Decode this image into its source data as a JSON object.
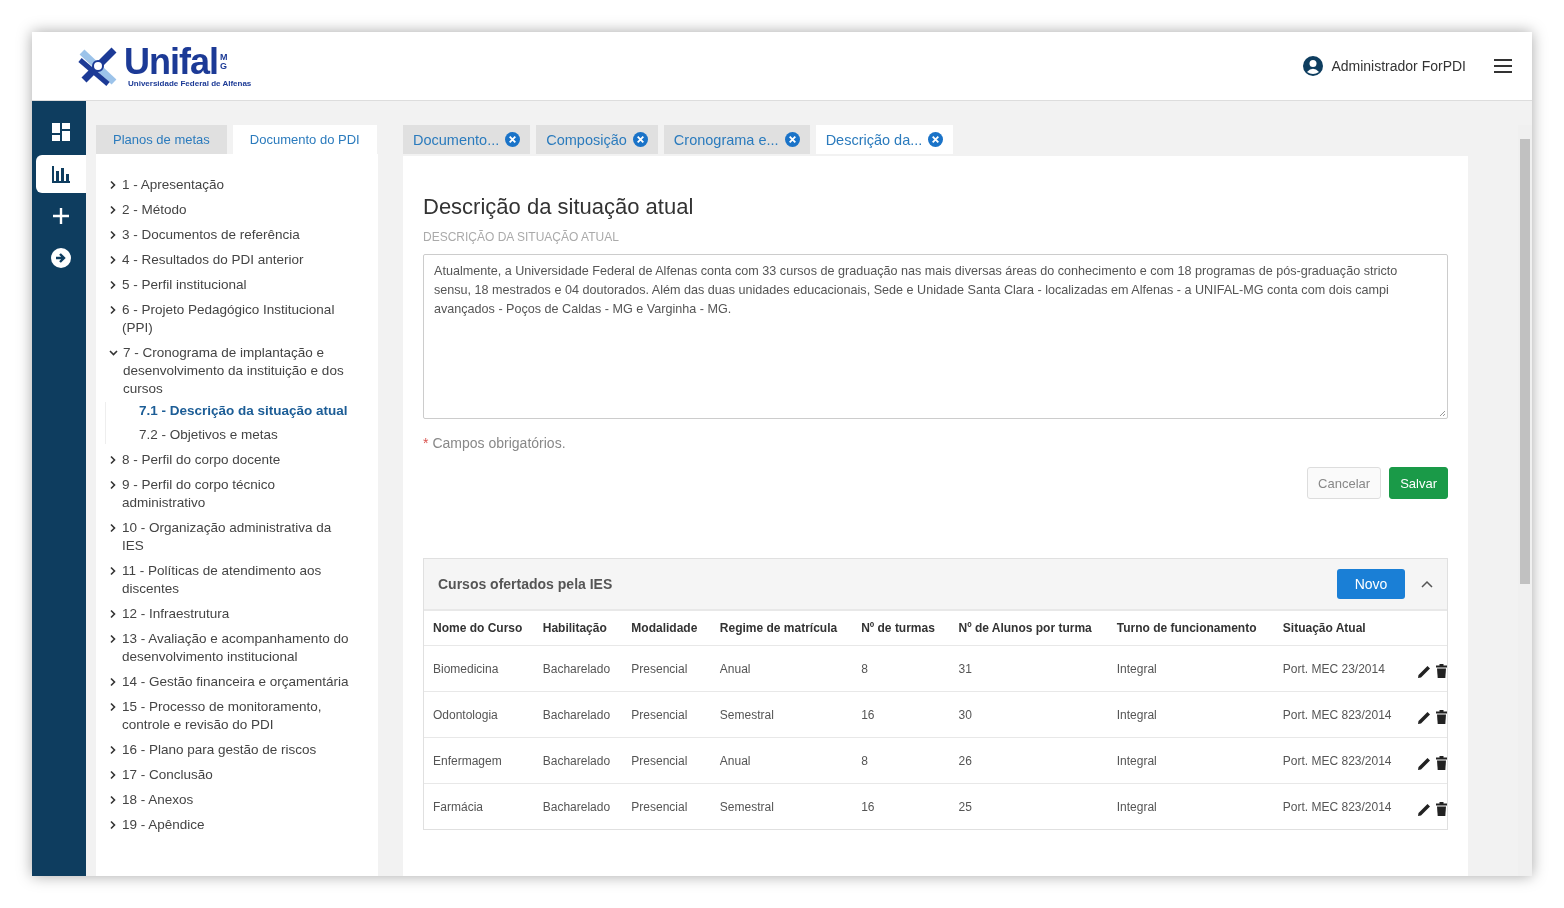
{
  "header": {
    "logo": {
      "name": "Unifal",
      "state": "MG",
      "subtitle": "Universidade Federal de Alfenas"
    },
    "user": "Administrador ForPDI"
  },
  "rail": [
    {
      "kind": "dashboard",
      "selected": false
    },
    {
      "kind": "chart",
      "selected": true
    },
    {
      "kind": "add",
      "selected": false
    },
    {
      "kind": "exit",
      "selected": false
    }
  ],
  "side_tabs": [
    {
      "label": "Planos de metas",
      "selected": false
    },
    {
      "label": "Documento do PDI",
      "selected": true
    }
  ],
  "tree": [
    {
      "label": "1 - Apresentação",
      "expanded": false
    },
    {
      "label": "2 - Método",
      "expanded": false
    },
    {
      "label": "3 - Documentos de referência",
      "expanded": false
    },
    {
      "label": "4 - Resultados do PDI anterior",
      "expanded": false
    },
    {
      "label": "5 - Perfil institucional",
      "expanded": false
    },
    {
      "label": "6 - Projeto Pedagógico Institucional (PPI)",
      "expanded": false
    },
    {
      "label": "7 - Cronograma de implantação e desenvolvimento da instituição e dos cursos",
      "expanded": true,
      "children": [
        {
          "label": "7.1 - Descrição da situação atual",
          "selected": true
        },
        {
          "label": "7.2 - Objetivos e metas",
          "selected": false
        }
      ]
    },
    {
      "label": "8 - Perfil do corpo docente",
      "expanded": false
    },
    {
      "label": "9 - Perfil do corpo técnico administrativo",
      "expanded": false
    },
    {
      "label": "10 - Organização administrativa da IES",
      "expanded": false
    },
    {
      "label": "11 - Políticas de atendimento aos discentes",
      "expanded": false
    },
    {
      "label": "12 - Infraestrutura",
      "expanded": false
    },
    {
      "label": "13 - Avaliação e acompanhamento do desenvolvimento institucional",
      "expanded": false
    },
    {
      "label": "14 - Gestão financeira e orçamentária",
      "expanded": false
    },
    {
      "label": "15 - Processo de monitoramento, controle e revisão do PDI",
      "expanded": false
    },
    {
      "label": "16 - Plano para gestão de riscos",
      "expanded": false
    },
    {
      "label": "17 - Conclusão",
      "expanded": false
    },
    {
      "label": "18 - Anexos",
      "expanded": false
    },
    {
      "label": "19 - Apêndice",
      "expanded": false
    }
  ],
  "doc_tabs": [
    {
      "label": "Documento...",
      "selected": false
    },
    {
      "label": "Composição",
      "selected": false
    },
    {
      "label": "Cronograma e...",
      "selected": false
    },
    {
      "label": "Descrição da...",
      "selected": true
    }
  ],
  "section": {
    "title": "Descrição da situação atual",
    "field_label": "DESCRIÇÃO DA SITUAÇÃO ATUAL",
    "field_value": "Atualmente, a Universidade Federal de Alfenas conta com 33 cursos de graduação nas mais diversas áreas do conhecimento e com 18 programas de pós-graduação stricto sensu, 18 mestrados e 04 doutorados. Além das duas unidades educacionais, Sede e Unidade Santa Clara - localizadas em Alfenas - a UNIFAL-MG conta com dois campi avançados - Poços de Caldas - MG e Varginha - MG.",
    "required_mark": "*",
    "required_note": "Campos obrigatórios.",
    "buttons": [
      "Cancelar",
      "Salvar"
    ]
  },
  "table_panel": {
    "title": "Cursos ofertados pela IES",
    "new_button": "Novo",
    "expanded": true,
    "columns": [
      "Nome do Curso",
      "Habilitação",
      "Modalidade",
      "Regime de matrícula",
      "Nº de turmas",
      "Nº de Alunos por turma",
      "Turno de funcionamento",
      "Situação Atual"
    ],
    "rows": [
      [
        "Biomedicina",
        "Bacharelado",
        "Presencial",
        "Anual",
        "8",
        "31",
        "Integral",
        "Port. MEC 23/2014"
      ],
      [
        "Odontologia",
        "Bacharelado",
        "Presencial",
        "Semestral",
        "16",
        "30",
        "Integral",
        "Port. MEC 823/2014"
      ],
      [
        "Enfermagem",
        "Bacharelado",
        "Presencial",
        "Anual",
        "8",
        "26",
        "Integral",
        "Port. MEC 823/2014"
      ],
      [
        "Farmácia",
        "Bacharelado",
        "Presencial",
        "Semestral",
        "16",
        "25",
        "Integral",
        "Port. MEC 823/2014"
      ]
    ]
  }
}
